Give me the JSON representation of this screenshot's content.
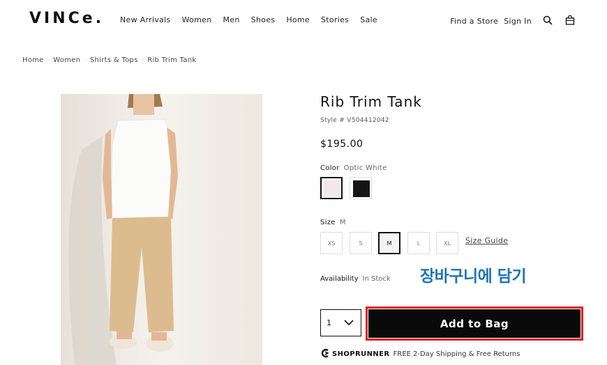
{
  "header": {
    "logo": "VINCe.",
    "nav": [
      "New Arrivals",
      "Women",
      "Men",
      "Shoes",
      "Home",
      "Stories",
      "Sale"
    ],
    "find_store": "Find a Store",
    "sign_in": "Sign In",
    "icons": [
      "search-icon",
      "bag-icon"
    ]
  },
  "breadcrumb": [
    "Home",
    "Women",
    "Shirts & Tops",
    "Rib Trim Tank"
  ],
  "product": {
    "title": "Rib Trim Tank",
    "style_number": "Style # V504412042",
    "price": "$195.00",
    "color_label": "Color",
    "color_value": "Optic White",
    "colors": [
      {
        "name": "Optic White",
        "hex": "#f1e8ec",
        "selected": true
      },
      {
        "name": "Black",
        "hex": "#141414",
        "selected": false
      }
    ],
    "size_label": "Size",
    "size_value": "M",
    "sizes": [
      {
        "label": "XS",
        "selected": false
      },
      {
        "label": "S",
        "selected": false
      },
      {
        "label": "M",
        "selected": true
      },
      {
        "label": "L",
        "selected": false
      },
      {
        "label": "XL",
        "selected": false
      }
    ],
    "size_guide": "Size Guide",
    "availability_label": "Availability",
    "availability_value": "In Stock",
    "quantity": "1",
    "add_to_bag": "Add to Bag"
  },
  "annotation": {
    "text": "장바구니에 담기",
    "color": "#1e74b8",
    "highlight_color": "#e21b1b"
  },
  "shoprunner": {
    "brand": "SHOPRUNNER",
    "promo": "FREE 2-Day Shipping & Free Returns"
  }
}
